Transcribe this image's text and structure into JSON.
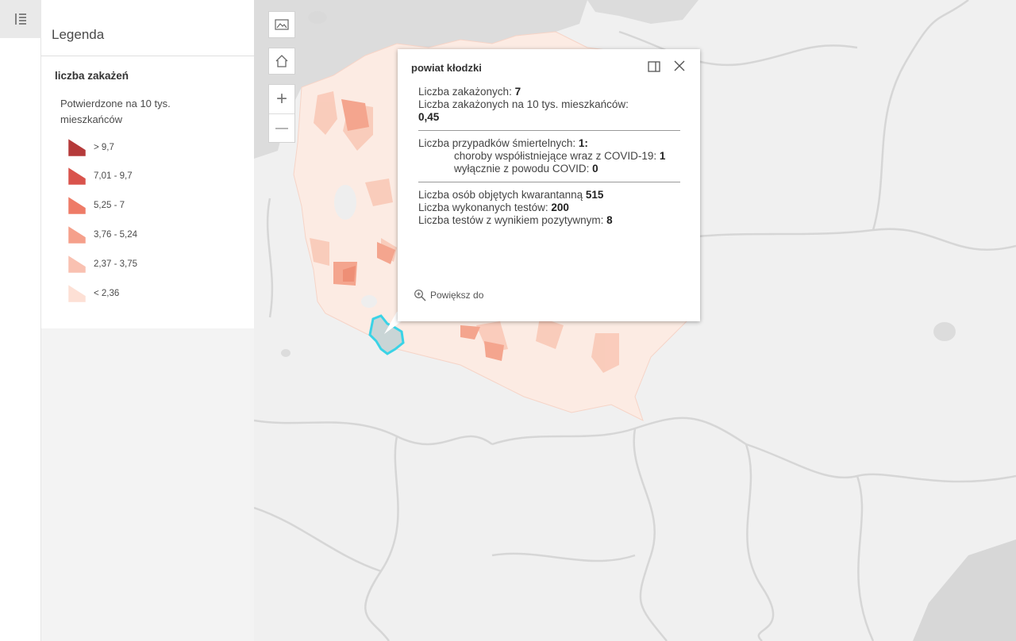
{
  "legend": {
    "title": "Legenda",
    "layer_name": "liczba zakażeń",
    "field_name": "Potwierdzone na 10 tys. mieszkańców",
    "classes": [
      {
        "label": "> 9,7",
        "color": "#b53a3a"
      },
      {
        "label": "7,01 - 9,7",
        "color": "#d9534c"
      },
      {
        "label": "5,25 - 7",
        "color": "#ee7b67"
      },
      {
        "label": "3,76 - 5,24",
        "color": "#f5a08b"
      },
      {
        "label": "2,37 - 3,75",
        "color": "#f9c1b1"
      },
      {
        "label": "< 2,36",
        "color": "#fde0d5"
      }
    ]
  },
  "icons": {
    "rail": "legend-list-icon",
    "basemap": "basemap-gallery-icon",
    "home": "home-icon",
    "zoom_in": "plus-icon",
    "zoom_out": "minus-icon",
    "dock": "dock-icon",
    "close": "close-icon",
    "zoom_to": "magnifier-plus-icon"
  },
  "map": {
    "zoom_in_label": "+",
    "zoom_out_label": "—",
    "selected_color": "#3ad3e6"
  },
  "popup": {
    "title": "powiat kłodzki",
    "infected_label": "Liczba zakażonych:",
    "infected_value": "7",
    "per10k_label": "Liczba zakażonych na 10 tys. mieszkańców:",
    "per10k_value": "0,45",
    "deaths_label": "Liczba przypadków śmiertelnych:",
    "deaths_value": "1",
    "comorbid_label": "choroby współistniejące wraz z COVID-19:",
    "comorbid_value": "1",
    "covid_only_label": "wyłącznie z powodu COVID:",
    "covid_only_value": "0",
    "quarantine_label": "Liczba osób objętych kwarantanną",
    "quarantine_value": "515",
    "tests_label": "Liczba wykonanych testów:",
    "tests_value": "200",
    "positive_label": "Liczba testów z wynikiem pozytywnym:",
    "positive_value": "8",
    "zoom_to_label": "Powiększ do"
  }
}
